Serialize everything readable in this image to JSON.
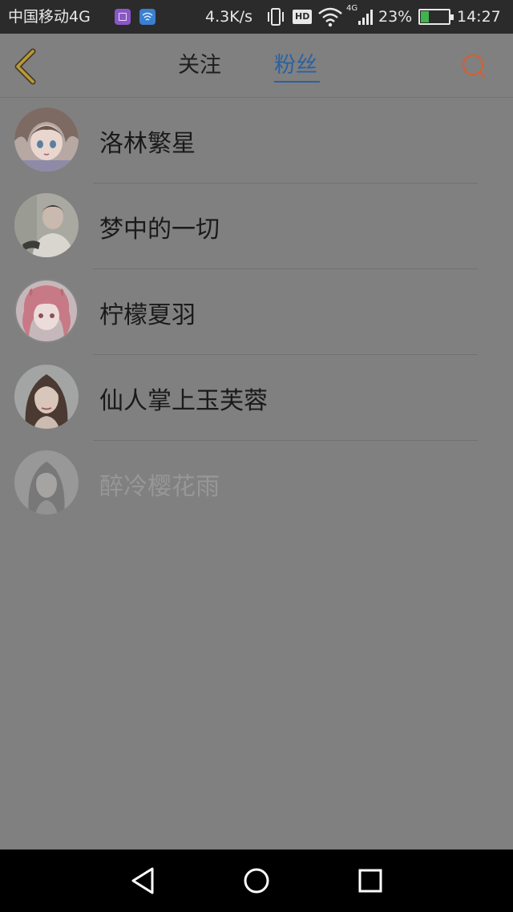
{
  "status_bar": {
    "carrier": "中国移动4G",
    "speed": "4.3K/s",
    "hd": "HD",
    "network": "4G",
    "battery_percent": "23%",
    "time": "14:27",
    "icons": [
      "gallery-app-icon",
      "wifi-app-icon",
      "vibrate-icon",
      "hd-icon",
      "wifi-icon",
      "signal-icon",
      "battery-charging-icon"
    ]
  },
  "header": {
    "tabs": [
      {
        "label": "关注",
        "active": false
      },
      {
        "label": "粉丝",
        "active": true
      }
    ],
    "icons": {
      "back": "back-chevron-icon",
      "search": "search-icon"
    },
    "accent_color": "#2a62a0",
    "search_color": "#c8643c"
  },
  "fans": [
    {
      "name": "洛林繁星",
      "avatar": "anime-girl-avatar"
    },
    {
      "name": "梦中的一切",
      "avatar": "young-man-avatar"
    },
    {
      "name": "柠檬夏羽",
      "avatar": "pink-anime-avatar"
    },
    {
      "name": "仙人掌上玉芙蓉",
      "avatar": "woman-portrait-avatar"
    },
    {
      "name": "醉冷樱花雨",
      "avatar": "girl-photo-avatar"
    }
  ],
  "nav_bar": {
    "icons": [
      "nav-back-icon",
      "nav-home-icon",
      "nav-recent-icon"
    ]
  }
}
